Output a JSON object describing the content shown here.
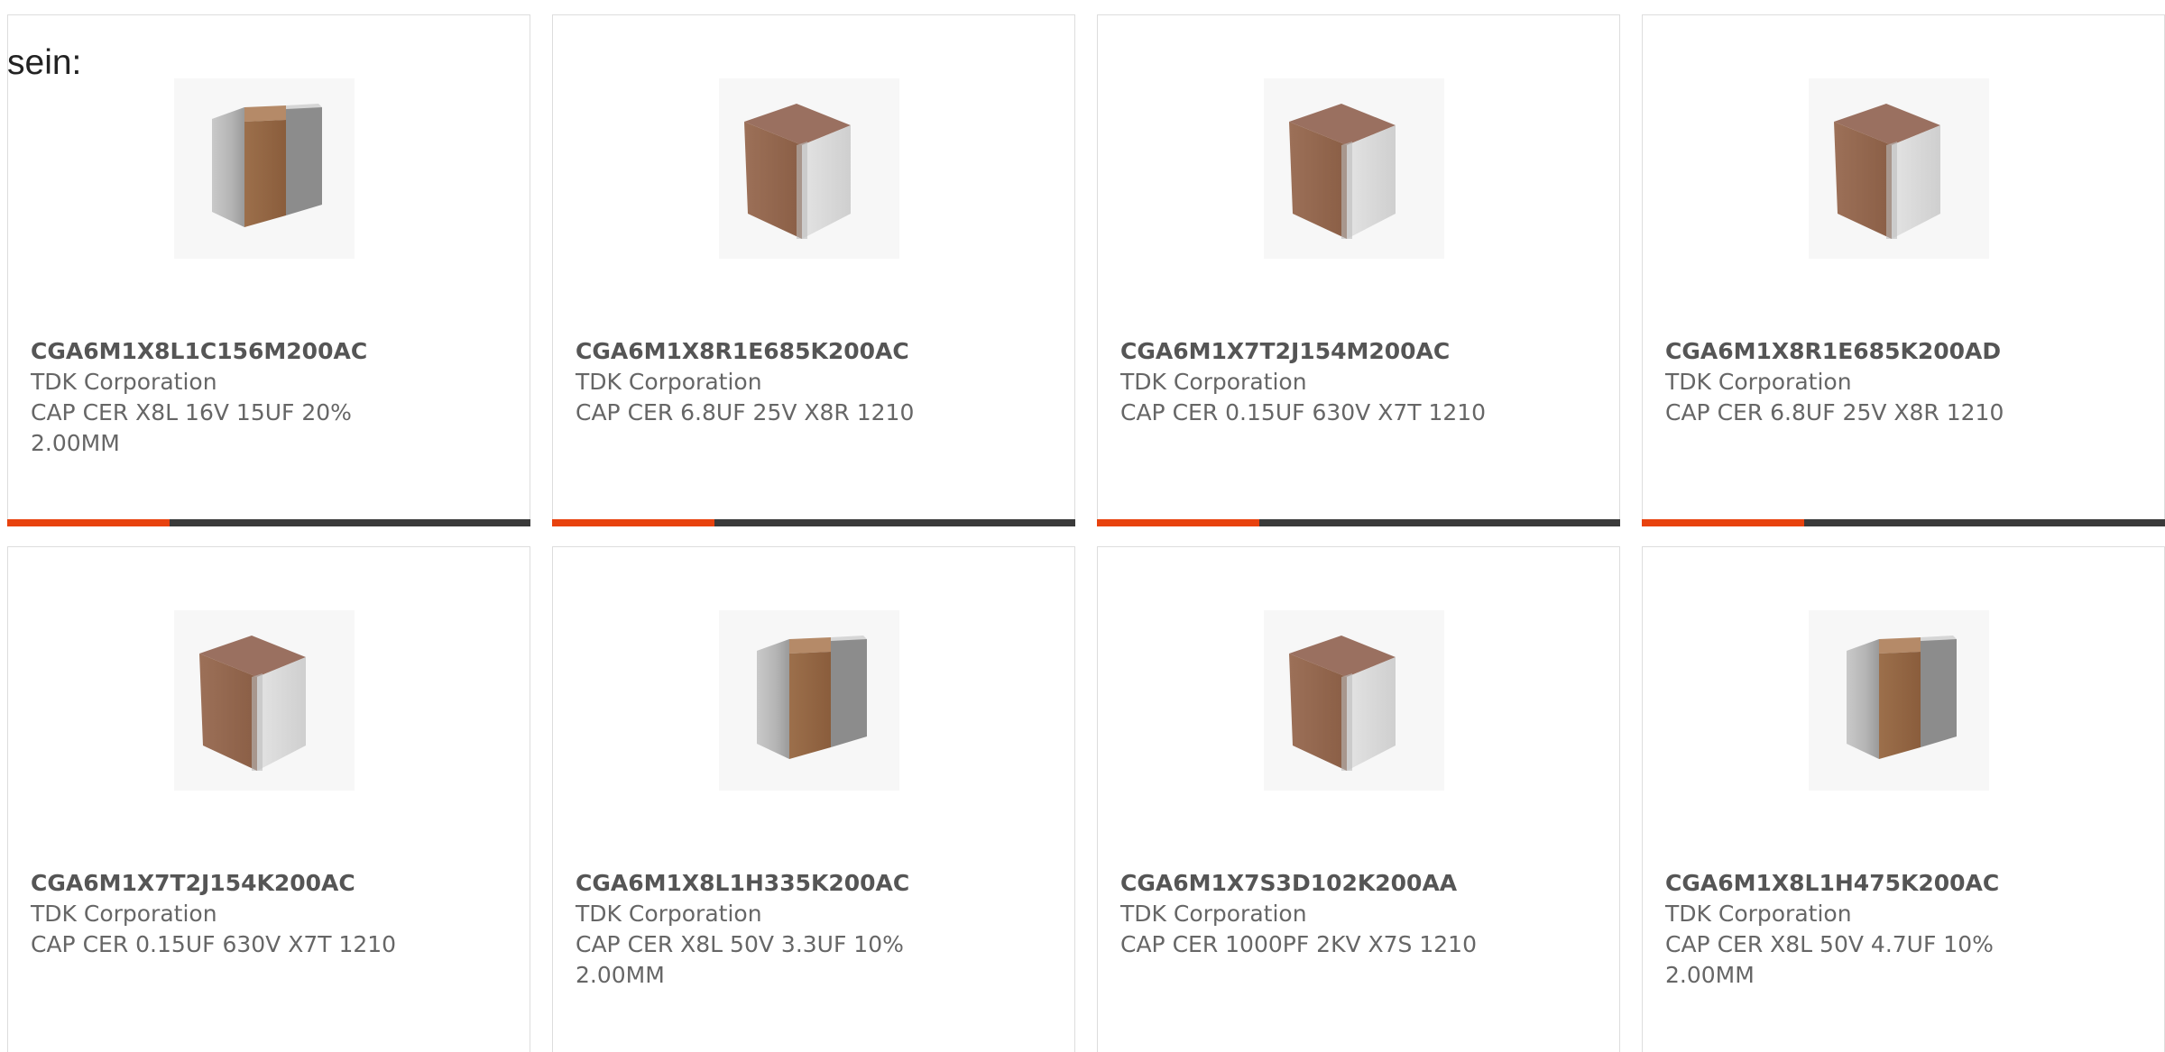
{
  "page": {
    "intro_text": "sein:",
    "colors": {
      "accent": "#e8420e",
      "track": "#3a3a3a",
      "card_border": "#dddddd",
      "text": "#666666",
      "part_number": "#555555"
    }
  },
  "products": [
    {
      "part_number": "CGA6M1X8L1C156M200AC",
      "manufacturer": "TDK Corporation",
      "description": "CAP CER X8L 16V 15UF 20% 2.00MM",
      "image_icon": "capacitor-side-view-image",
      "has_progress": true,
      "progress_fraction": 0.31
    },
    {
      "part_number": "CGA6M1X8R1E685K200AC",
      "manufacturer": "TDK Corporation",
      "description": "CAP CER 6.8UF 25V X8R 1210",
      "image_icon": "capacitor-front-view-image",
      "has_progress": true,
      "progress_fraction": 0.31
    },
    {
      "part_number": "CGA6M1X7T2J154M200AC",
      "manufacturer": "TDK Corporation",
      "description": "CAP CER 0.15UF 630V X7T 1210",
      "image_icon": "capacitor-front-view-image",
      "has_progress": true,
      "progress_fraction": 0.31
    },
    {
      "part_number": "CGA6M1X8R1E685K200AD",
      "manufacturer": "TDK Corporation",
      "description": "CAP CER 6.8UF 25V X8R 1210",
      "image_icon": "capacitor-front-view-image",
      "has_progress": true,
      "progress_fraction": 0.31
    },
    {
      "part_number": "CGA6M1X7T2J154K200AC",
      "manufacturer": "TDK Corporation",
      "description": "CAP CER 0.15UF 630V X7T 1210",
      "image_icon": "capacitor-front-view-image",
      "has_progress": false
    },
    {
      "part_number": "CGA6M1X8L1H335K200AC",
      "manufacturer": "TDK Corporation",
      "description": "CAP CER X8L 50V 3.3UF 10% 2.00MM",
      "image_icon": "capacitor-side-view-image",
      "has_progress": false
    },
    {
      "part_number": "CGA6M1X7S3D102K200AA",
      "manufacturer": "TDK Corporation",
      "description": "CAP CER 1000PF 2KV X7S 1210",
      "image_icon": "capacitor-front-view-image",
      "has_progress": false
    },
    {
      "part_number": "CGA6M1X8L1H475K200AC",
      "manufacturer": "TDK Corporation",
      "description": "CAP CER X8L 50V 4.7UF 10% 2.00MM",
      "image_icon": "capacitor-side-view-image",
      "has_progress": false
    }
  ]
}
